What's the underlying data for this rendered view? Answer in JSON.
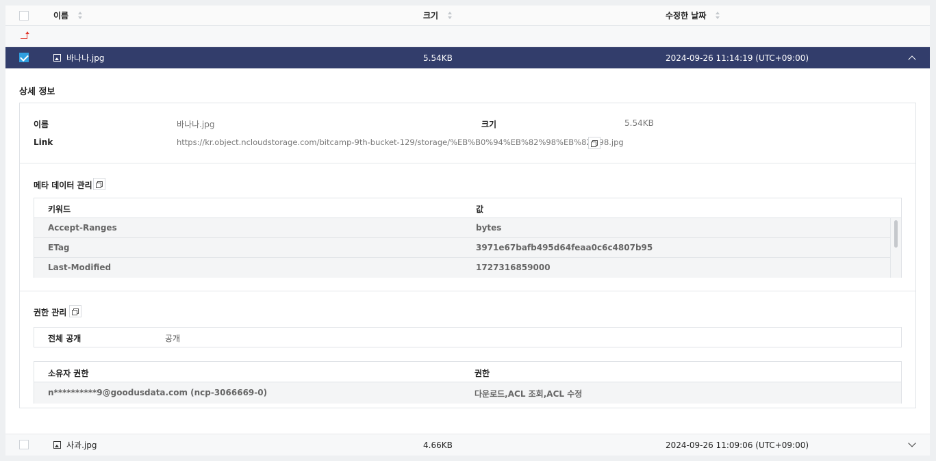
{
  "header": {
    "col_name": "이름",
    "col_size": "크기",
    "col_modified": "수정한 날짜"
  },
  "rows": [
    {
      "name": "바나나.jpg",
      "size": "5.54KB",
      "modified": "2024-09-26 11:14:19 (UTC+09:00)"
    },
    {
      "name": "사과.jpg",
      "size": "4.66KB",
      "modified": "2024-09-26 11:09:06 (UTC+09:00)"
    }
  ],
  "details": {
    "title": "상세 정보",
    "name_label": "이름",
    "name_value": "바나나.jpg",
    "size_label": "크기",
    "size_value": "5.54KB",
    "link_label": "Link",
    "link_value": "https://kr.object.ncloudstorage.com/bitcamp-9th-bucket-129/storage/%EB%B0%94%EB%82%98%EB%82%98.jpg"
  },
  "metadata": {
    "title": "메타 데이터 관리",
    "col_key": "키워드",
    "col_value": "값",
    "rows": [
      {
        "key": "Accept-Ranges",
        "value": "bytes"
      },
      {
        "key": "ETag",
        "value": "3971e67bafb495d64feaa0c6c4807b95"
      },
      {
        "key": "Last-Modified",
        "value": "1727316859000"
      }
    ]
  },
  "permissions": {
    "title": "권한 관리",
    "public_label": "전체 공개",
    "public_value": "공개",
    "col_owner": "소유자 권한",
    "col_perm": "권한",
    "owner": "n**********9@goodusdata.com (ncp-3066669-0)",
    "perm": "다운로드,ACL 조회,ACL 수정"
  },
  "colors": {
    "selected_row": "#323d6b",
    "checkbox": "#2f9fe0"
  }
}
